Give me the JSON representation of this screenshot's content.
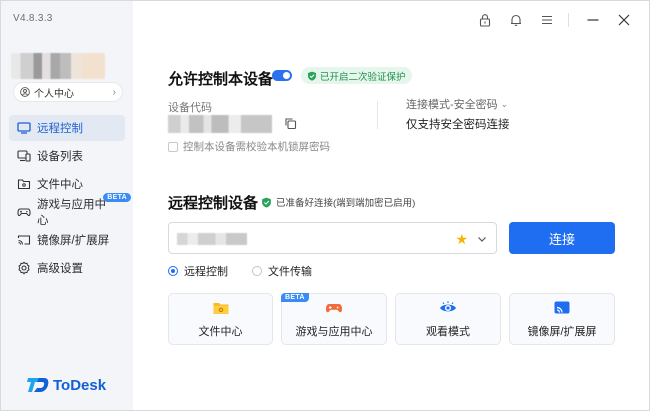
{
  "app": {
    "version": "V4.8.3.3",
    "brand": "ToDesk",
    "brand_color": "#1060d8",
    "accent_color": "#1f6ef2"
  },
  "titlebar": {
    "icons": [
      "lock-icon",
      "bell-icon",
      "menu-icon",
      "minimize-icon",
      "close-icon"
    ]
  },
  "sidebar": {
    "personal_center": "个人中心",
    "items": [
      {
        "label": "远程控制",
        "icon": "remote-control-icon",
        "active": true
      },
      {
        "label": "设备列表",
        "icon": "device-list-icon"
      },
      {
        "label": "文件中心",
        "icon": "file-center-icon"
      },
      {
        "label": "游戏与应用中心",
        "icon": "gamepad-icon",
        "badge": "BETA"
      },
      {
        "label": "镜像屏/扩展屏",
        "icon": "mirror-screen-icon"
      },
      {
        "label": "高级设置",
        "icon": "gear-icon"
      }
    ]
  },
  "allow_control": {
    "title": "允许控制本设备",
    "toggle_on": true,
    "verify_badge": "已开启二次验证保护",
    "device_code_label": "设备代码",
    "lock_checkbox": "控制本设备需校验本机锁屏密码",
    "conn_mode_label": "连接模式-安全密码",
    "conn_mode_value": "仅支持安全密码连接"
  },
  "remote_control": {
    "title": "远程控制设备",
    "ready_status": "已准备好连接(端到端加密已启用)",
    "connect_button": "连接",
    "modes": [
      {
        "label": "远程控制",
        "checked": true
      },
      {
        "label": "文件传输",
        "checked": false
      }
    ]
  },
  "quick_cards": [
    {
      "label": "文件中心",
      "icon": "folder-icon"
    },
    {
      "label": "游戏与应用中心",
      "icon": "gamepad-icon",
      "badge": "BETA"
    },
    {
      "label": "观看模式",
      "icon": "eye-icon"
    },
    {
      "label": "镜像屏/扩展屏",
      "icon": "cast-icon"
    }
  ]
}
